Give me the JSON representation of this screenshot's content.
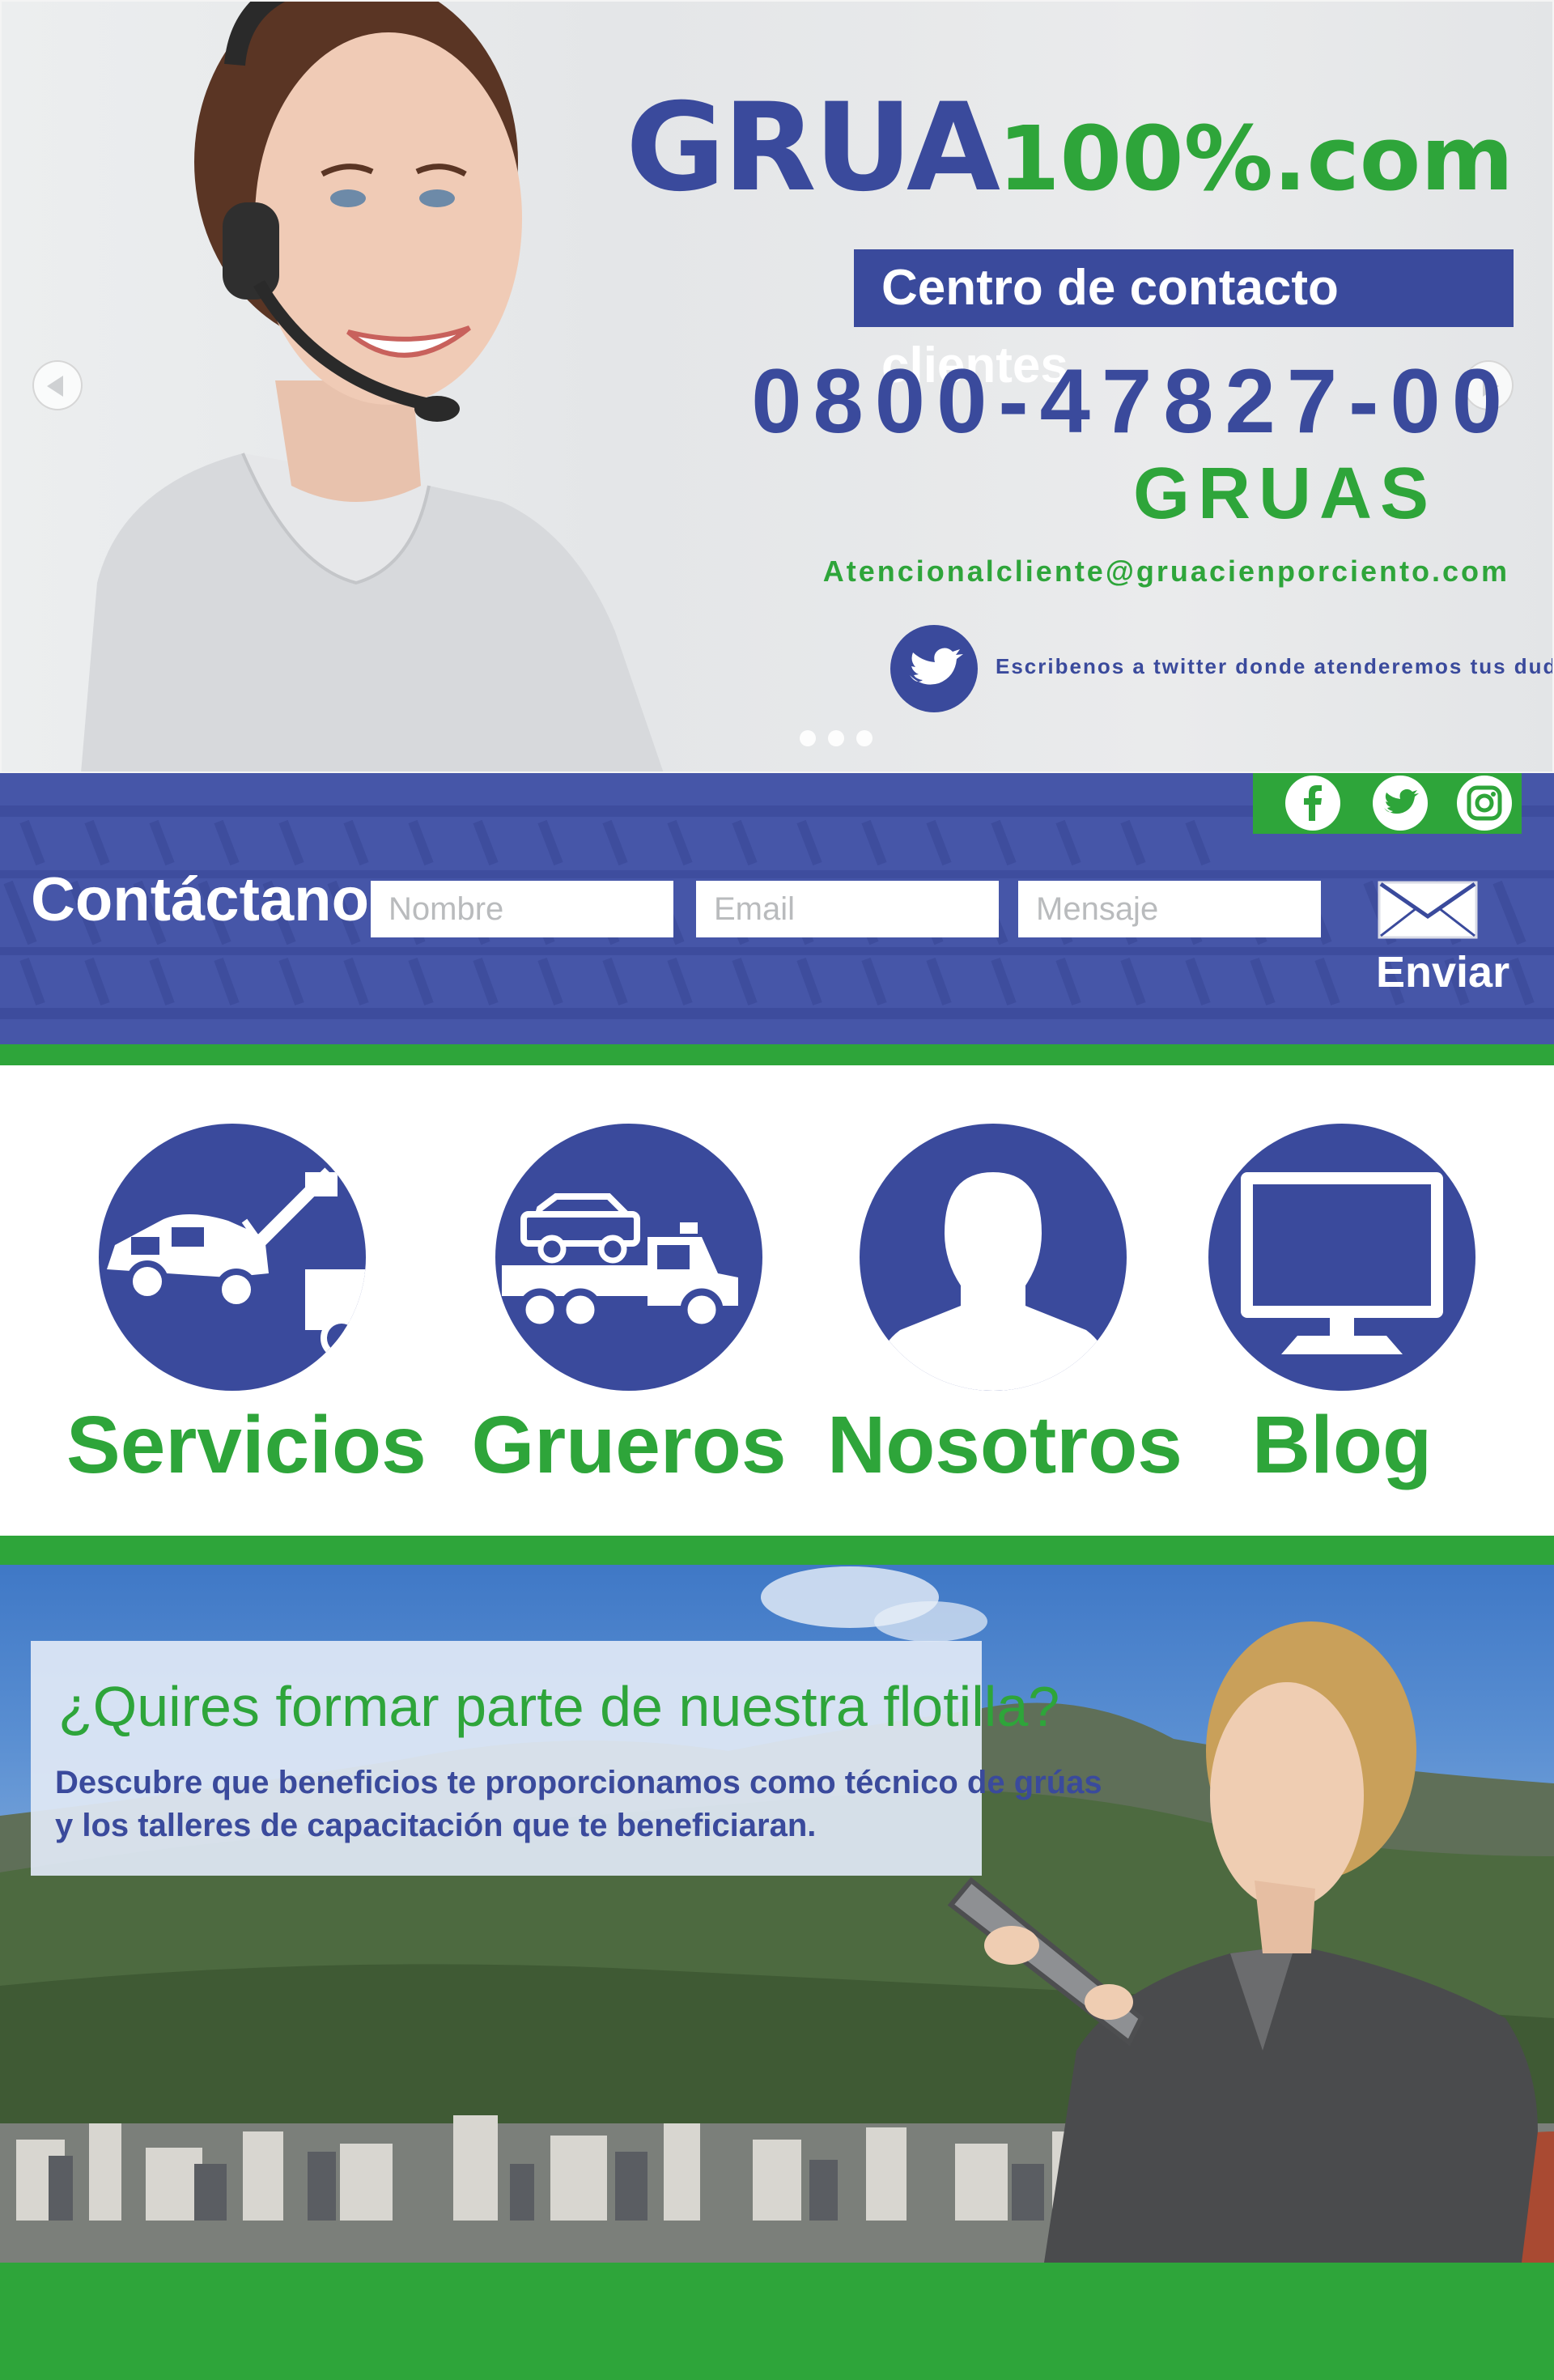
{
  "hero": {
    "logo_main": "GRUA",
    "logo_suffix": "100%.com",
    "contact_center": "Centro de contacto clientes",
    "phone": "0800-47827-00",
    "phone_word": "GRUAS",
    "email": "Atencionalcliente@gruacienporciento.com",
    "twitter_text": "Escribenos a twitter donde atenderemos tus dudas"
  },
  "contact": {
    "title": "Contáctanos",
    "name_placeholder": "Nombre",
    "email_placeholder": "Email",
    "message_placeholder": "Mensaje",
    "send_label": "Enviar"
  },
  "nav": {
    "items": [
      {
        "label": "Servicios",
        "icon": "tow-truck-icon"
      },
      {
        "label": "Grueros",
        "icon": "flatbed-truck-icon"
      },
      {
        "label": "Nosotros",
        "icon": "person-silhouette-icon"
      },
      {
        "label": "Blog",
        "icon": "monitor-icon"
      }
    ]
  },
  "recruit": {
    "title": "¿Quires formar parte de nuestra flotilla?",
    "line1": "Descubre que beneficios te proporcionamos como técnico de grúas",
    "line2": "y los talleres de capacitación que te beneficiaran."
  },
  "colors": {
    "brand_blue": "#3a4a9c",
    "brand_green": "#2ea53a",
    "bar_blue": "#4656a8"
  }
}
